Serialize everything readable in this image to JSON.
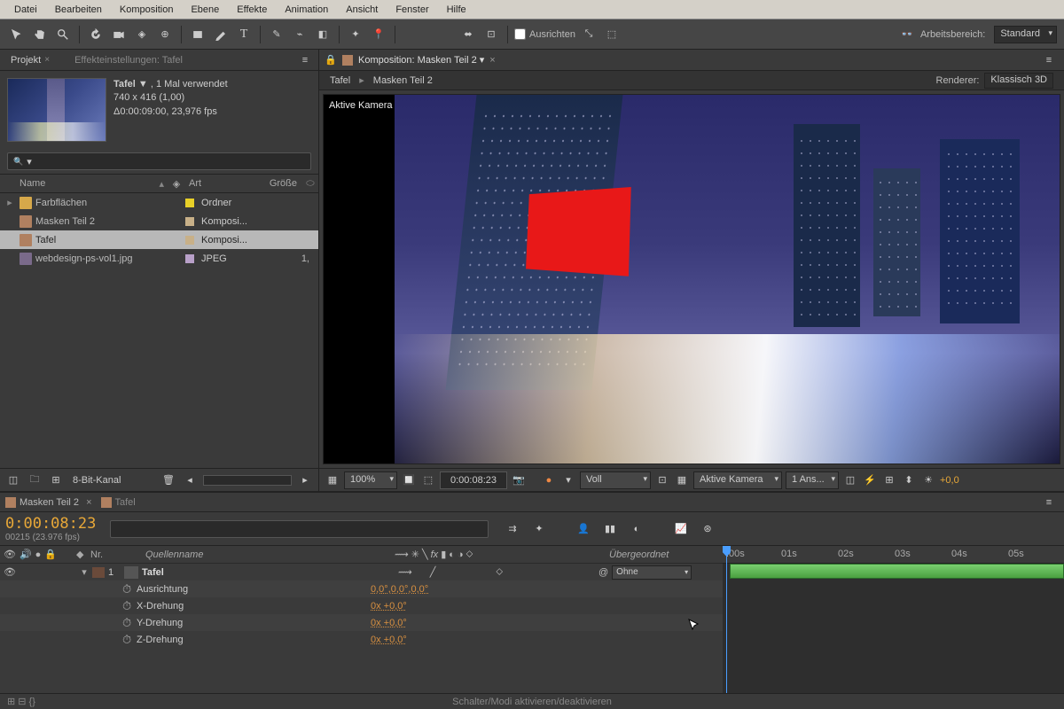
{
  "menu": [
    "Datei",
    "Bearbeiten",
    "Komposition",
    "Ebene",
    "Effekte",
    "Animation",
    "Ansicht",
    "Fenster",
    "Hilfe"
  ],
  "toolbar": {
    "align_label": "Ausrichten",
    "workspace_label": "Arbeitsbereich:",
    "workspace_value": "Standard"
  },
  "project": {
    "tab1": "Projekt",
    "tab2": "Effekteinstellungen: Tafel",
    "selected_name": "Tafel",
    "selected_suffix": ", 1 Mal verwendet",
    "dim": "740 x 416 (1,00)",
    "dur": "Δ0:00:09:00, 23,976 fps",
    "cols": {
      "name": "Name",
      "art": "Art",
      "size": "Größe"
    },
    "items": [
      {
        "name": "Farbflächen",
        "art": "Ordner",
        "size": "",
        "folder": true,
        "color": "#e8d028"
      },
      {
        "name": "Masken Teil 2",
        "art": "Komposi...",
        "size": "",
        "color": "#c8b088"
      },
      {
        "name": "Tafel",
        "art": "Komposi...",
        "size": "",
        "sel": true,
        "color": "#c8b088"
      },
      {
        "name": "webdesign-ps-vol1.jpg",
        "art": "JPEG",
        "size": "1,",
        "color": "#b8a0c8"
      }
    ],
    "footer_label": "8-Bit-Kanal"
  },
  "comp": {
    "tab_prefix": "Komposition:",
    "tab_name": "Masken Teil 2",
    "crumb1": "Tafel",
    "crumb2": "Masken Teil 2",
    "renderer_label": "Renderer:",
    "renderer_value": "Klassisch 3D",
    "viewer_label": "Aktive Kamera",
    "footer": {
      "zoom": "100%",
      "timecode": "0:00:08:23",
      "res": "Voll",
      "view": "Aktive Kamera",
      "views": "1 Ans...",
      "exposure": "+0,0"
    }
  },
  "timeline": {
    "tab1": "Masken Teil 2",
    "tab2": "Tafel",
    "timecode": "0:00:08:23",
    "frame_info": "00215 (23.976 fps)",
    "col_nr": "Nr.",
    "col_source": "Quellenname",
    "col_parent": "Übergeordnet",
    "layer": {
      "num": "1",
      "name": "Tafel",
      "parent": "Ohne",
      "props": [
        {
          "name": "Ausrichtung",
          "value": "0,0°,0,0°,0,0°"
        },
        {
          "name": "X-Drehung",
          "value": "0x +0,0°"
        },
        {
          "name": "Y-Drehung",
          "value": "0x +0,0°"
        },
        {
          "name": "Z-Drehung",
          "value": "0x +0,0°"
        }
      ]
    },
    "ruler": [
      ":00s",
      "01s",
      "02s",
      "03s",
      "04s",
      "05s"
    ],
    "foot_hint": "Schalter/Modi aktivieren/deaktivieren"
  }
}
